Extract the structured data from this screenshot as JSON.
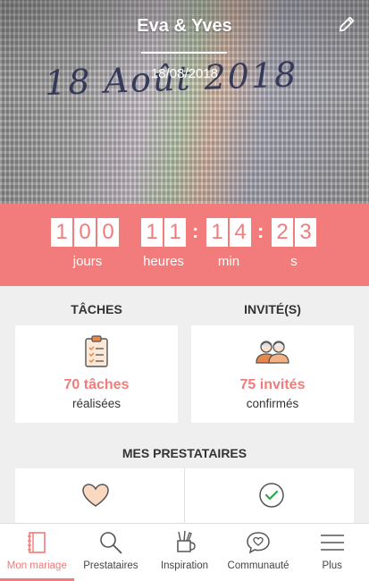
{
  "header": {
    "couple_names": "Eva & Yves",
    "wedding_date": "18/08/2018",
    "photo_caption": "18 Août 2018",
    "edit_icon": "pencil-icon"
  },
  "countdown": {
    "days": {
      "digits": [
        "1",
        "0",
        "0"
      ],
      "label": "jours"
    },
    "hours": {
      "digits": [
        "1",
        "1"
      ],
      "label": "heures"
    },
    "minutes": {
      "digits": [
        "1",
        "4"
      ],
      "label": "min"
    },
    "seconds": {
      "digits": [
        "2",
        "3"
      ],
      "label": "s"
    },
    "separator": ":"
  },
  "tasks": {
    "title": "TÂCHES",
    "count": "70 tâches",
    "status": "réalisées",
    "icon": "clipboard-checklist-icon"
  },
  "guests": {
    "title": "INVITÉ(S)",
    "count": "75 invités",
    "status": "confirmés",
    "icon": "guests-couple-icon"
  },
  "vendors": {
    "title": "MES PRESTATAIRES",
    "left_icon": "heart-icon",
    "right_icon": "check-circle-icon"
  },
  "nav": {
    "items": [
      {
        "label": "Mon mariage",
        "icon": "notebook-icon",
        "active": true
      },
      {
        "label": "Prestataires",
        "icon": "search-icon"
      },
      {
        "label": "Inspiration",
        "icon": "tools-cup-icon"
      },
      {
        "label": "Communauté",
        "icon": "chat-heart-icon"
      },
      {
        "label": "Plus",
        "icon": "menu-icon"
      }
    ]
  },
  "colors": {
    "accent": "#f27b7b",
    "background": "#efefef",
    "icon_orange": "#e8874a"
  }
}
